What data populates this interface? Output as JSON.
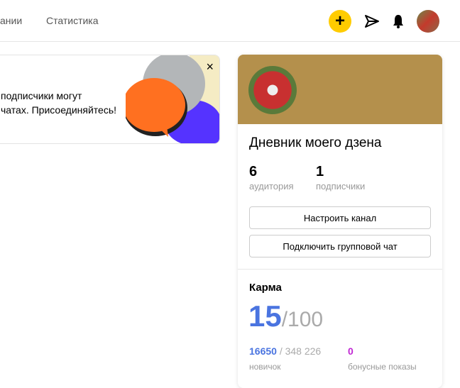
{
  "header": {
    "nav": [
      "ании",
      "Статистика"
    ]
  },
  "banner": {
    "line1": "подписчики могут",
    "line2": "чатах. Присоединяйтесь!",
    "close": "×"
  },
  "channel": {
    "title": "Дневник моего дзена",
    "audience": {
      "value": "6",
      "label": "аудитория"
    },
    "subscribers": {
      "value": "1",
      "label": "подписчики"
    },
    "configure_label": "Настроить канал",
    "chat_label": "Подключить групповой чат"
  },
  "karma": {
    "title": "Карма",
    "value": "15",
    "max": "/100",
    "score": "16650",
    "score_total": " / 348 226",
    "level": "новичок",
    "bonus": "0",
    "bonus_label": "бонусные показы"
  },
  "colors": {
    "accent": "#4a74e0",
    "bonus": "#c026d3",
    "yellow": "#ffcc00"
  }
}
